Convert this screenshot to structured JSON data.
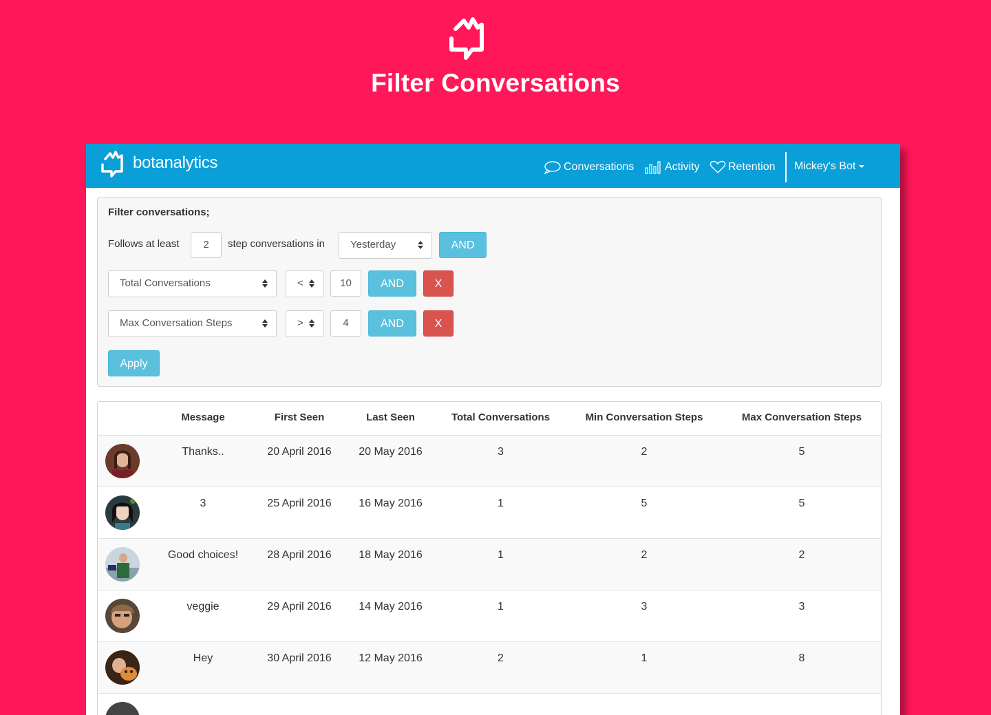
{
  "page": {
    "title": "Filter Conversations"
  },
  "navbar": {
    "brand": "botanalytics",
    "items": [
      {
        "label": "Conversations",
        "icon": "chat-bubble-icon"
      },
      {
        "label": "Activity",
        "icon": "bar-chart-icon"
      },
      {
        "label": "Retention",
        "icon": "heart-icon"
      }
    ],
    "user_menu": "Mickey's Bot"
  },
  "filter": {
    "title": "Filter conversations;",
    "follows_label": "Follows at least",
    "steps_value": "2",
    "steps_label": "step conversations in",
    "period": "Yesterday",
    "and_label": "AND",
    "remove_label": "X",
    "apply_label": "Apply",
    "conditions": [
      {
        "field": "Total Conversations",
        "operator": "<",
        "value": "10"
      },
      {
        "field": "Max Conversation Steps",
        "operator": ">",
        "value": "4"
      }
    ]
  },
  "table": {
    "headers": [
      "Message",
      "First Seen",
      "Last Seen",
      "Total Conversations",
      "Min Conversation Steps",
      "Max Conversation Steps"
    ],
    "rows": [
      {
        "message": "Thanks..",
        "first_seen": "20 April 2016",
        "last_seen": "20 May 2016",
        "total": "3",
        "min_steps": "2",
        "max_steps": "5"
      },
      {
        "message": "3",
        "first_seen": "25 April 2016",
        "last_seen": "16 May 2016",
        "total": "1",
        "min_steps": "5",
        "max_steps": "5"
      },
      {
        "message": "Good choices!",
        "first_seen": "28 April 2016",
        "last_seen": "18 May 2016",
        "total": "1",
        "min_steps": "2",
        "max_steps": "2"
      },
      {
        "message": "veggie",
        "first_seen": "29 April 2016",
        "last_seen": "14 May 2016",
        "total": "1",
        "min_steps": "3",
        "max_steps": "3"
      },
      {
        "message": "Hey",
        "first_seen": "30 April 2016",
        "last_seen": "12 May 2016",
        "total": "2",
        "min_steps": "1",
        "max_steps": "8"
      }
    ]
  },
  "colors": {
    "background": "#ff1759",
    "navbar": "#0a9fd8",
    "info": "#5bc0de",
    "danger": "#d9534f"
  }
}
